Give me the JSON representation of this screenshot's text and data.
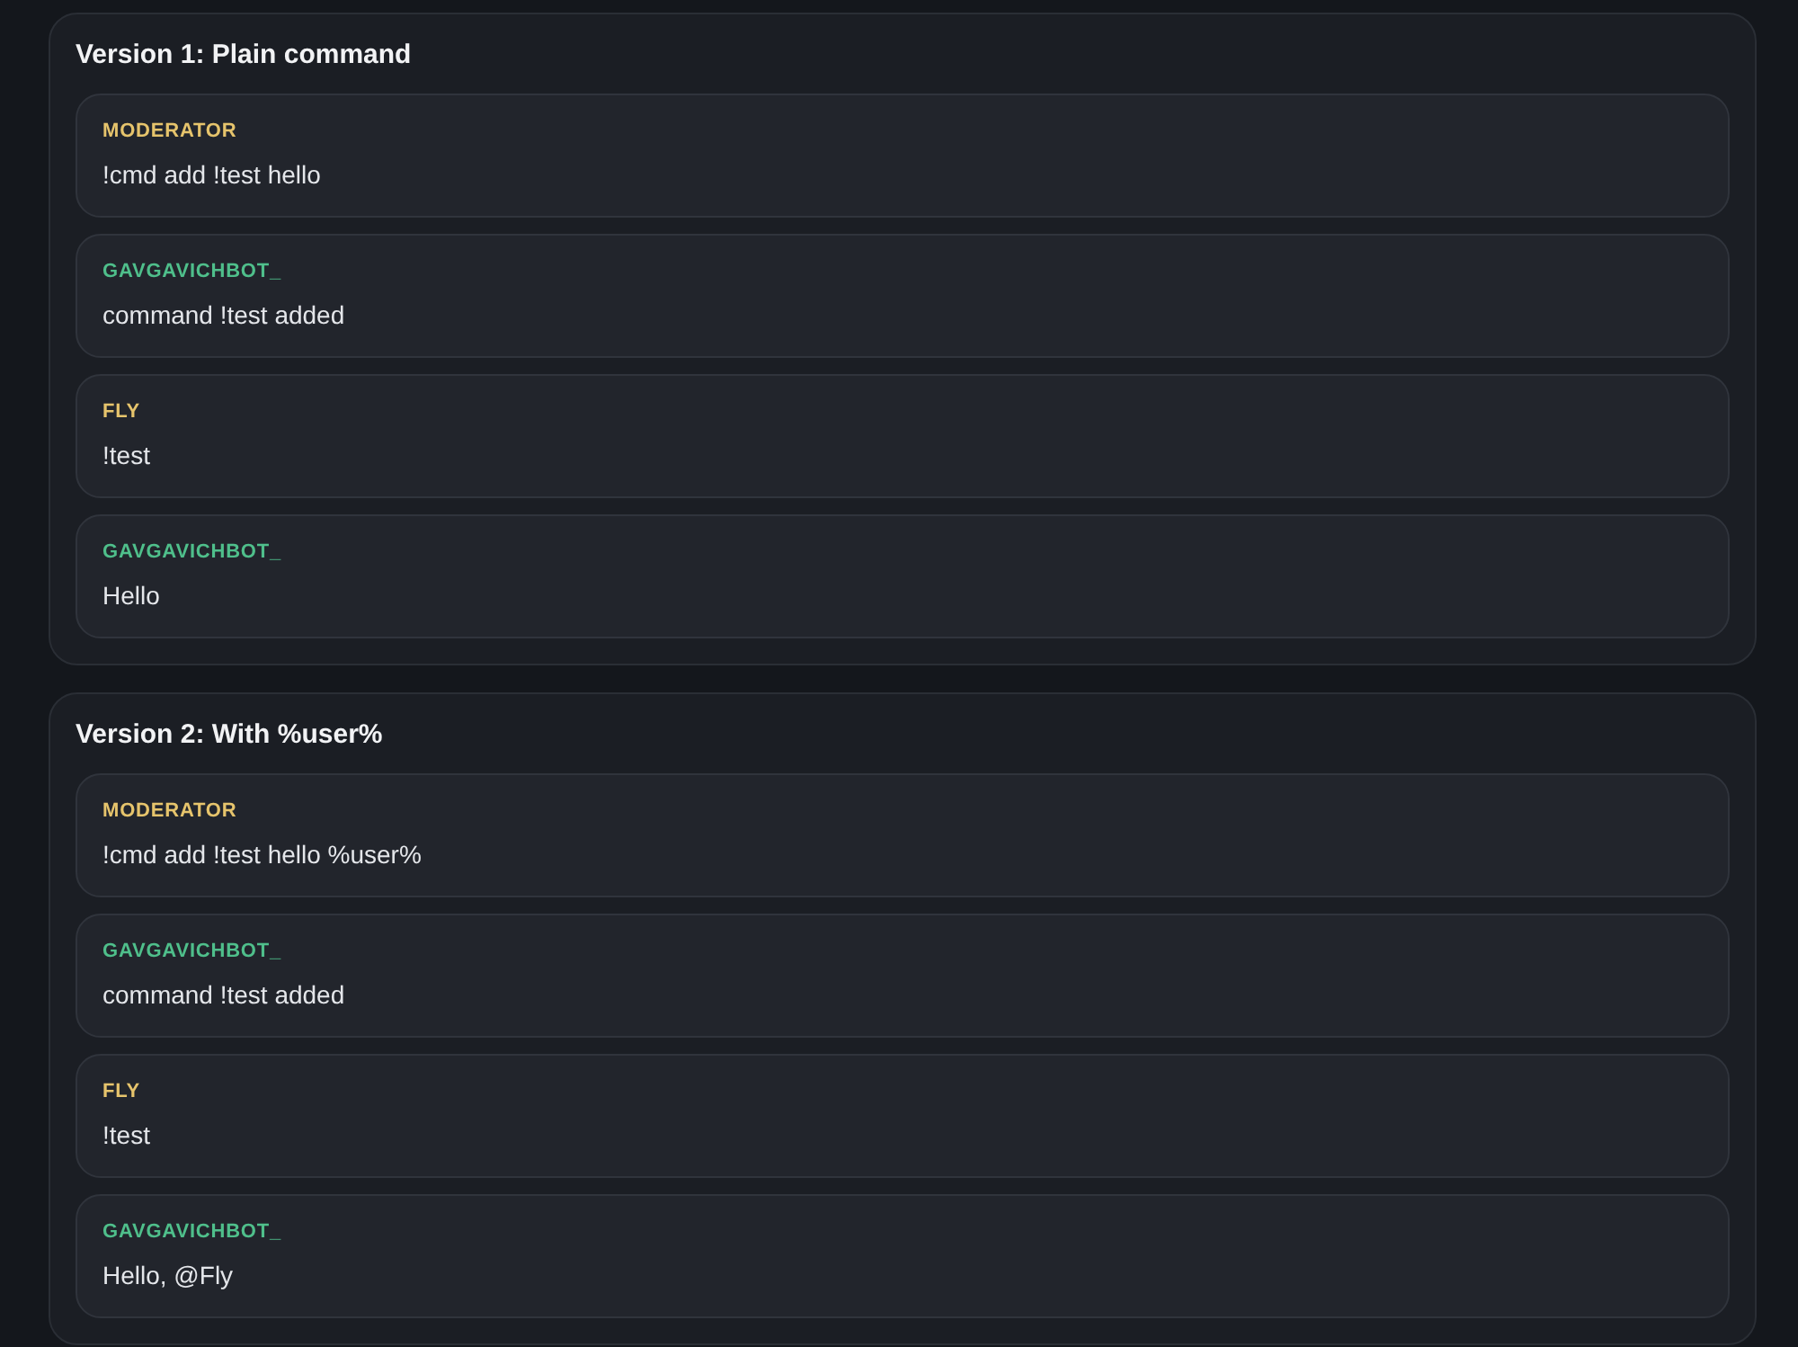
{
  "sections": [
    {
      "title": "Version 1: Plain command",
      "messages": [
        {
          "author": "MODERATOR",
          "color": "#e6c46c",
          "text": "!cmd add !test hello"
        },
        {
          "author": "GAVGAVICHBOT_",
          "color": "#4fbf8b",
          "text": "command !test added"
        },
        {
          "author": "FLY",
          "color": "#e6c46c",
          "text": "!test"
        },
        {
          "author": "GAVGAVICHBOT_",
          "color": "#4fbf8b",
          "text": "Hello"
        }
      ]
    },
    {
      "title": "Version 2: With %user%",
      "messages": [
        {
          "author": "MODERATOR",
          "color": "#e6c46c",
          "text": "!cmd add !test hello %user%"
        },
        {
          "author": "GAVGAVICHBOT_",
          "color": "#4fbf8b",
          "text": "command !test added"
        },
        {
          "author": "FLY",
          "color": "#e6c46c",
          "text": "!test"
        },
        {
          "author": "GAVGAVICHBOT_",
          "color": "#4fbf8b",
          "text": "Hello, @Fly"
        }
      ]
    }
  ]
}
